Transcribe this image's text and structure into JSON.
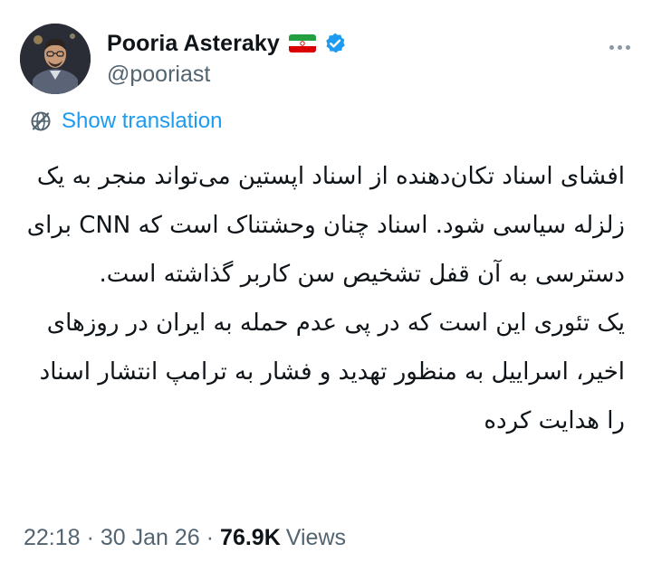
{
  "author": {
    "display_name": "Pooria Asteraky",
    "handle": "@pooriast",
    "flag_icon": "iran-flag-icon",
    "verified_icon": "verified-badge-icon",
    "verified_color": "#1d9bf0"
  },
  "translate": {
    "icon": "globe-translate-icon",
    "label": "Show translation",
    "color": "#1d9bf0"
  },
  "more_icon": "more-options-icon",
  "body": {
    "paragraph_1": "افشای اسناد تکان‌دهنده از اسناد اپستین می‌تواند منجر به یک زلزله سیاسی شود. اسناد چنان وحشتناک است که CNN برای دسترسی به آن قفل تشخیص سن کاربر گذاشته است.",
    "paragraph_2": "یک تئوری این است که در پی عدم حمله به ایران در روزهای اخیر، اسراییل به منظور تهدید و فشار به ترامپ انتشار اسناد را هدایت کرده"
  },
  "meta": {
    "time": "22:18",
    "separator": "·",
    "date": "30 Jan 26",
    "views_count": "76.9K",
    "views_label": "Views"
  }
}
